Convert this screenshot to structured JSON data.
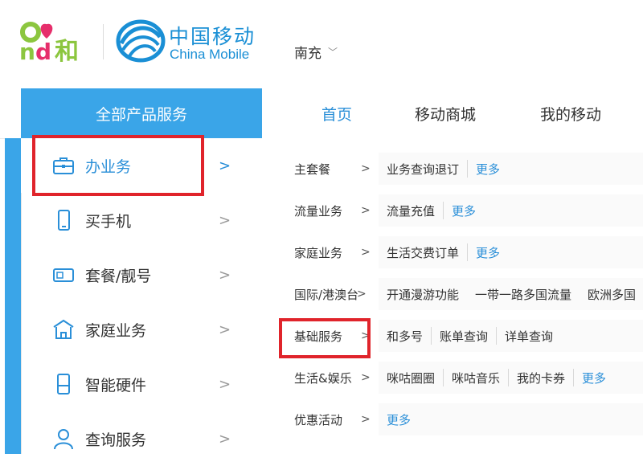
{
  "header": {
    "logo_cn": "中国移动",
    "logo_en": "China Mobile",
    "and_logo_text": "and和",
    "city": "南充"
  },
  "nav": {
    "all_services": "全部产品服务",
    "links": [
      {
        "label": "首页",
        "active": true
      },
      {
        "label": "移动商城",
        "active": false
      },
      {
        "label": "我的移动",
        "active": false
      }
    ]
  },
  "sidebar": {
    "items": [
      {
        "label": "办业务",
        "icon": "briefcase-icon",
        "active": true
      },
      {
        "label": "买手机",
        "icon": "phone-icon",
        "active": false
      },
      {
        "label": "套餐/靓号",
        "icon": "sim-card-icon",
        "active": false
      },
      {
        "label": "家庭业务",
        "icon": "home-icon",
        "active": false
      },
      {
        "label": "智能硬件",
        "icon": "device-icon",
        "active": false
      },
      {
        "label": "查询服务",
        "icon": "user-icon",
        "active": false
      }
    ]
  },
  "content": {
    "rows": [
      {
        "category": "主套餐",
        "links": [
          "业务查询退订"
        ],
        "more": "更多"
      },
      {
        "category": "流量业务",
        "links": [
          "流量充值"
        ],
        "more": "更多"
      },
      {
        "category": "家庭业务",
        "links": [
          "生活交费订单"
        ],
        "more": "更多"
      },
      {
        "category": "国际/港澳台",
        "links": [
          "开通漫游功能",
          "一带一路多国流量",
          "欧洲多国"
        ],
        "more": ""
      },
      {
        "category": "基础服务",
        "links": [
          "和多号",
          "账单查询",
          "详单查询"
        ],
        "more": ""
      },
      {
        "category": "生活&娱乐",
        "links": [
          "咪咕圈圈",
          "咪咕音乐",
          "我的卡券"
        ],
        "more": "更多"
      },
      {
        "category": "优惠活动",
        "links": [],
        "more": "更多"
      }
    ]
  },
  "colors": {
    "brand_blue": "#3aa5e8",
    "link_blue": "#2a8fd8",
    "highlight_red": "#e0242b"
  }
}
